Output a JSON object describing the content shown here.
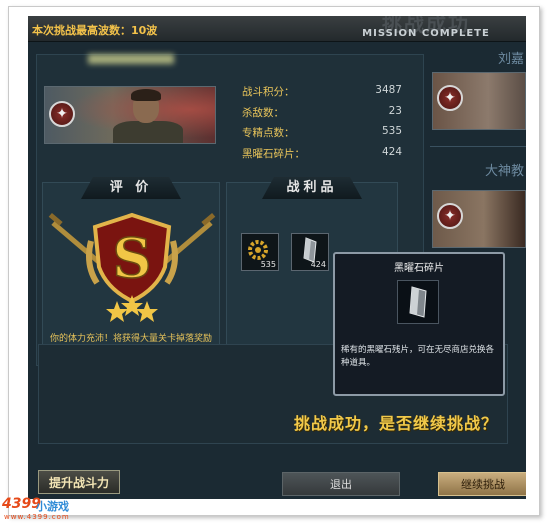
{
  "header": {
    "wave_text": "本次挑战最高波数：10波",
    "mission_big": "挑战成功",
    "mission_small": "MISSION COMPLETE"
  },
  "stats": [
    {
      "label": "战斗积分：",
      "value": "3487"
    },
    {
      "label": "杀敌数：",
      "value": "23"
    },
    {
      "label": "专精点数：",
      "value": "535"
    },
    {
      "label": "黑曜石碎片：",
      "value": "424"
    }
  ],
  "rating": {
    "title": "评 价",
    "grade": "S",
    "message": "你的体力充沛！将获得大量关卡掉落奖励"
  },
  "loot": {
    "title": "战利品",
    "items": [
      {
        "icon": "gear-icon",
        "count": "535"
      },
      {
        "icon": "obsidian-shard-icon",
        "count": "424"
      }
    ]
  },
  "tooltip": {
    "title": "黑曜石碎片",
    "description": "稀有的黑曜石残片，可在无尽商店兑换各种道具。"
  },
  "prompt": "挑战成功，是否继续挑战？",
  "teammates": [
    {
      "name": "刘嘉"
    },
    {
      "name": "大神教"
    }
  ],
  "buttons": {
    "upgrade": "提升战斗力",
    "exit": "退出",
    "continue": "继续挑战"
  },
  "watermark": {
    "logo": "4399",
    "logo_text": "小游戏",
    "url": "www.4399.com"
  },
  "colors": {
    "gold_text": "#e8c45a",
    "panel_bg": "#1b2a33",
    "accent_red": "#8a2e2a"
  }
}
